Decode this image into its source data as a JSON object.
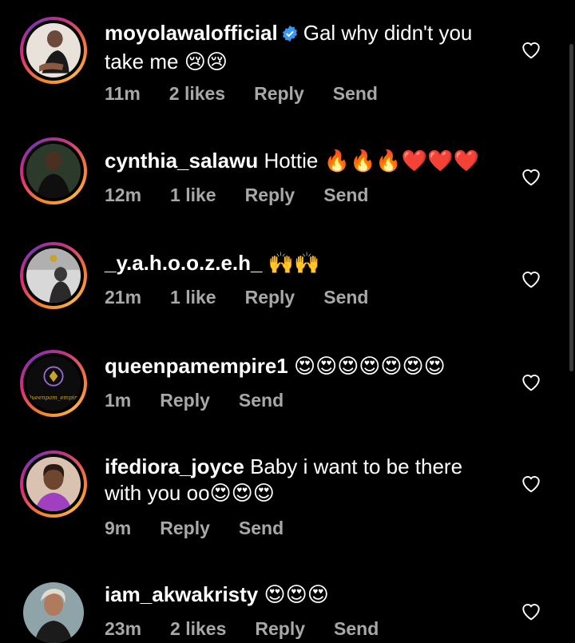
{
  "comments": [
    {
      "username": "moyolawalofficial",
      "verified": true,
      "text": "Gal why didn't you take me",
      "emoji": "😢😢",
      "time": "11m",
      "likes": "2 likes",
      "reply": "Reply",
      "send": "Send"
    },
    {
      "username": "cynthia_salawu",
      "text": "Hottie",
      "emoji": "🔥🔥🔥❤️❤️❤️",
      "time": "12m",
      "likes": "1 like",
      "reply": "Reply",
      "send": "Send"
    },
    {
      "username": "_y.a.h.o.o.z.e.h_",
      "text": "",
      "emoji": "🙌🙌",
      "time": "21m",
      "likes": "1 like",
      "reply": "Reply",
      "send": "Send"
    },
    {
      "username": "queenpamempire1",
      "text": "",
      "emoji": "😍😍😍😍😍😍😍",
      "avatar_text": "Queenpam_empire",
      "time": "1m",
      "reply": "Reply",
      "send": "Send"
    },
    {
      "username": "ifediora_joyce",
      "text": "Baby i want to be there with you oo",
      "emoji": "😍😍😍",
      "time": "9m",
      "reply": "Reply",
      "send": "Send"
    },
    {
      "username": "iam_akwakristy",
      "text": "",
      "emoji": "😍😍😍",
      "time": "23m",
      "likes": "2 likes",
      "reply": "Reply",
      "send": "Send"
    }
  ],
  "colors": {
    "background": "#000000",
    "text": "#ffffff",
    "meta": "#a8a8a8",
    "verified": "#3897f0"
  },
  "icons": [
    "verified-badge-icon",
    "heart-outline-icon"
  ]
}
